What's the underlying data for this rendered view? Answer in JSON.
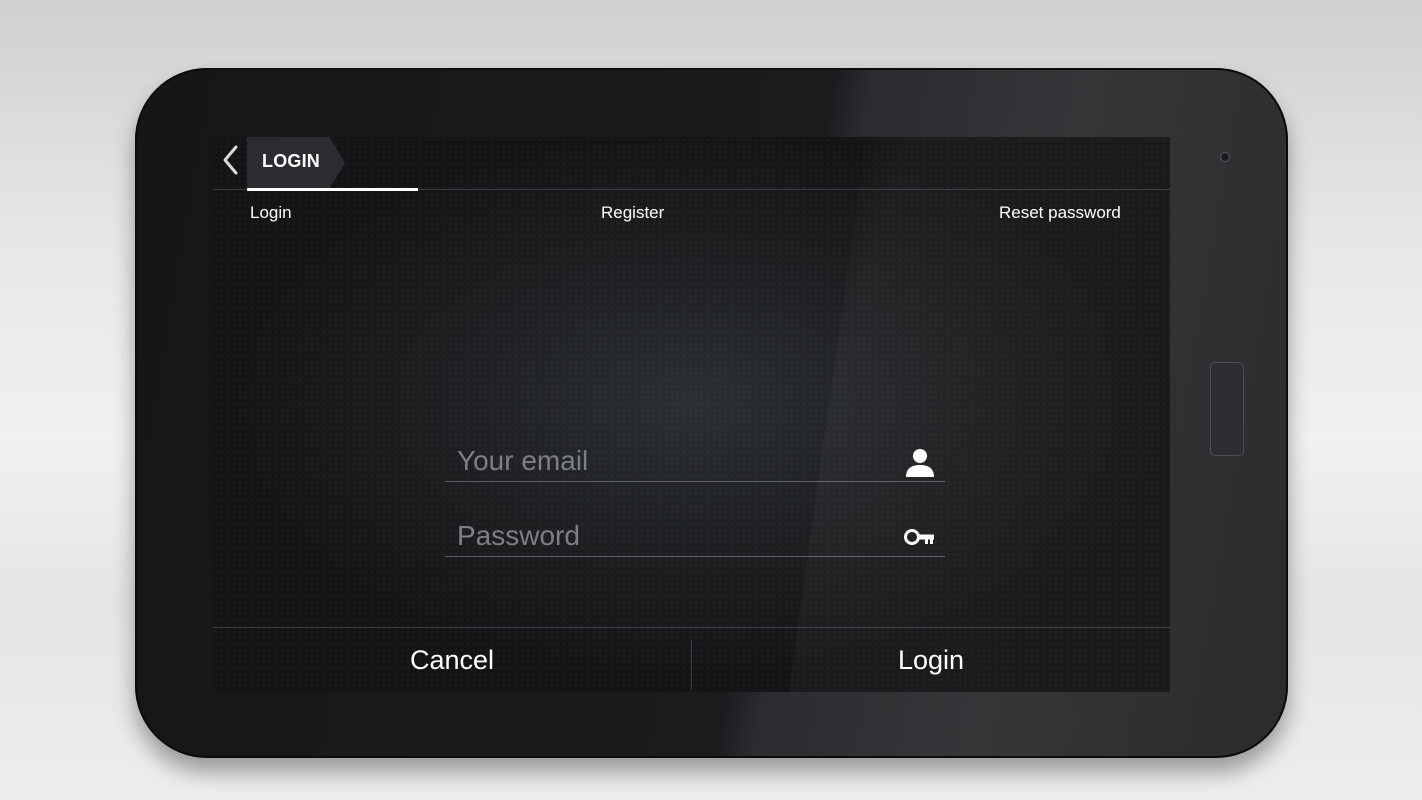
{
  "action_bar": {
    "title": "LOGIN",
    "back_icon": "chevron-left-icon"
  },
  "tabs": [
    {
      "label": "Login",
      "selected": true
    },
    {
      "label": "Register",
      "selected": false
    },
    {
      "label": "Reset password",
      "selected": false
    }
  ],
  "form": {
    "email": {
      "placeholder": "Your email",
      "value": "",
      "icon": "user-icon"
    },
    "password": {
      "placeholder": "Password",
      "value": "",
      "icon": "key-icon"
    }
  },
  "buttons": {
    "cancel_label": "Cancel",
    "login_label": "Login"
  },
  "colors": {
    "screen_background": "#1c1e20",
    "text": "#ffffff",
    "placeholder": "#7d8083",
    "divider": "#3b3e41"
  }
}
